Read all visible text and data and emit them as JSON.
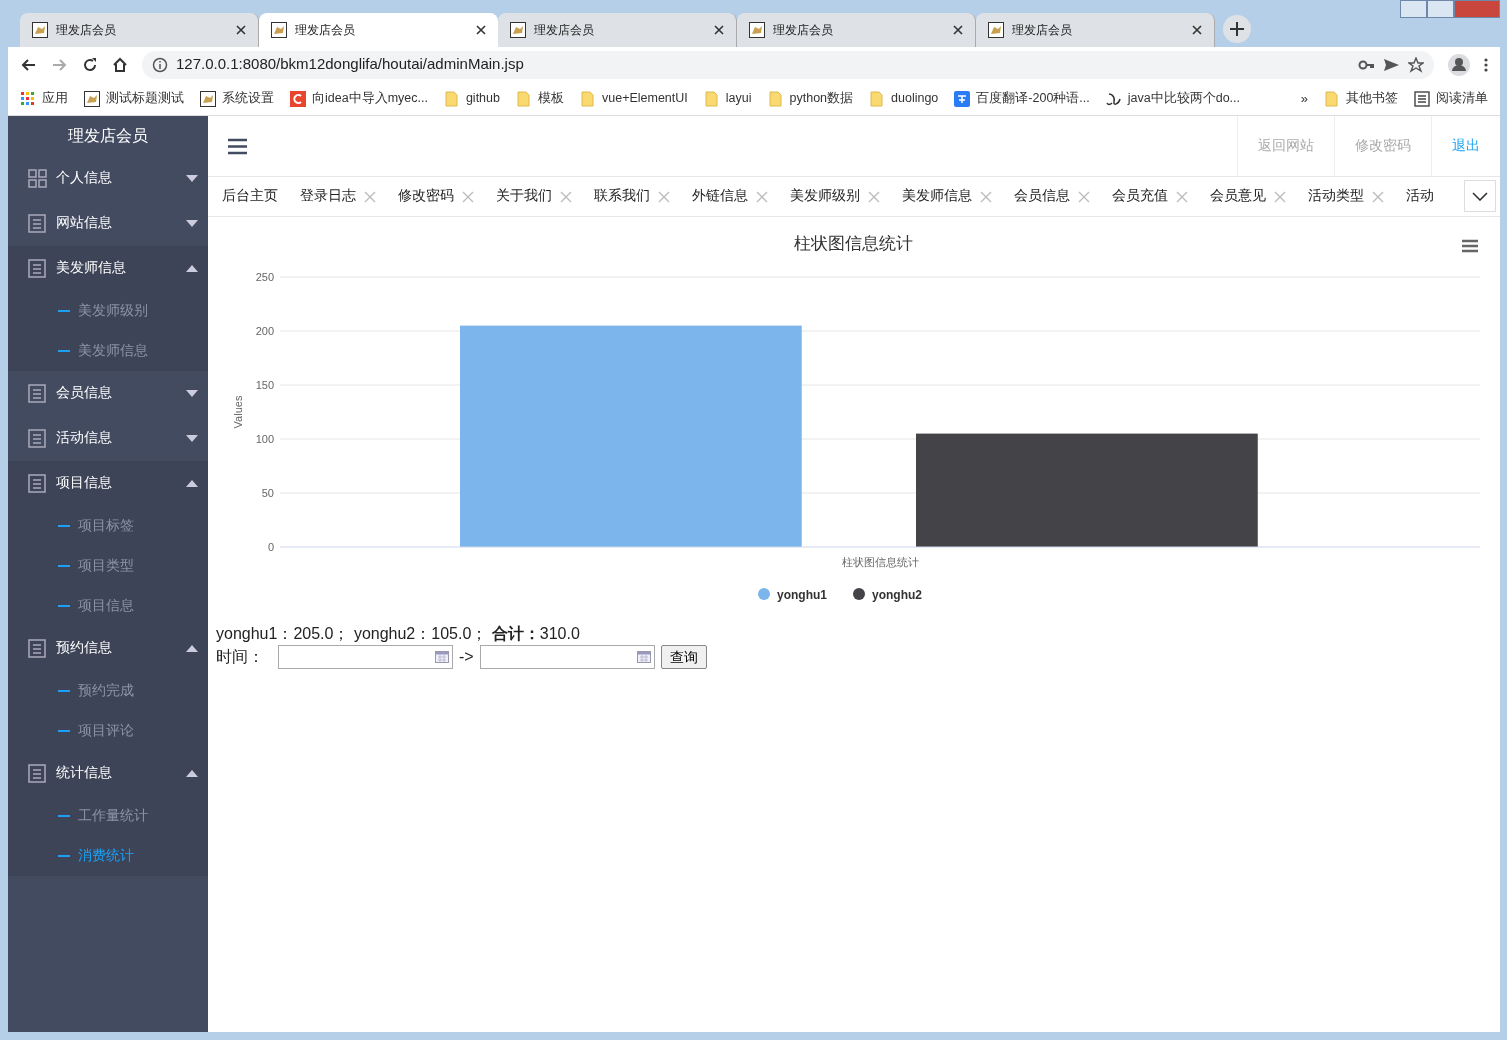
{
  "browser": {
    "tabs": [
      {
        "title": "理发店会员",
        "selected": false
      },
      {
        "title": "理发店会员",
        "selected": true
      },
      {
        "title": "理发店会员",
        "selected": false
      },
      {
        "title": "理发店会员",
        "selected": false
      },
      {
        "title": "理发店会员",
        "selected": false
      }
    ],
    "address": {
      "url": "127.0.0.1:8080/bkm12donglifa/houtai/adminMain.jsp"
    },
    "bookmarks": [
      {
        "label": "应用",
        "kind": "apps"
      },
      {
        "label": "测试标题测试",
        "kind": "page"
      },
      {
        "label": "系统设置",
        "kind": "page"
      },
      {
        "label": "向idea中导入myec...",
        "kind": "red"
      },
      {
        "label": "github",
        "kind": "folder"
      },
      {
        "label": "模板",
        "kind": "folder"
      },
      {
        "label": "vue+ElementUI",
        "kind": "folder"
      },
      {
        "label": "layui",
        "kind": "folder"
      },
      {
        "label": "python数据",
        "kind": "folder"
      },
      {
        "label": "duolingo",
        "kind": "folder"
      },
      {
        "label": "百度翻译-200种语...",
        "kind": "translate"
      },
      {
        "label": "java中比较两个do...",
        "kind": "link"
      }
    ],
    "more": "»",
    "other_bookmarks": "其他书签",
    "reading_list": "阅读清单"
  },
  "sidebar": {
    "title": "理发店会员",
    "groups": [
      {
        "label": "个人信息",
        "kind": "grid",
        "expanded": false
      },
      {
        "label": "网站信息",
        "kind": "list",
        "expanded": false
      },
      {
        "label": "美发师信息",
        "kind": "list",
        "expanded": true,
        "children": [
          {
            "label": "美发师级别",
            "selected": false
          },
          {
            "label": "美发师信息",
            "selected": false
          }
        ]
      },
      {
        "label": "会员信息",
        "kind": "list",
        "expanded": false
      },
      {
        "label": "活动信息",
        "kind": "list",
        "expanded": false
      },
      {
        "label": "项目信息",
        "kind": "list",
        "expanded": true,
        "children": [
          {
            "label": "项目标签",
            "selected": false
          },
          {
            "label": "项目类型",
            "selected": false
          },
          {
            "label": "项目信息",
            "selected": false
          }
        ]
      },
      {
        "label": "预约信息",
        "kind": "list",
        "expanded": true,
        "children": [
          {
            "label": "预约完成",
            "selected": false
          },
          {
            "label": "项目评论",
            "selected": false
          }
        ]
      },
      {
        "label": "统计信息",
        "kind": "list",
        "expanded": true,
        "children": [
          {
            "label": "工作量统计",
            "selected": false
          },
          {
            "label": "消费统计",
            "selected": true
          }
        ]
      }
    ]
  },
  "header": {
    "links": [
      {
        "label": "返回网站",
        "kind": "muted"
      },
      {
        "label": "修改密码",
        "kind": "muted"
      },
      {
        "label": "退出",
        "kind": "primary"
      }
    ]
  },
  "page_tabs": [
    {
      "label": "后台主页",
      "closable": false
    },
    {
      "label": "登录日志",
      "closable": true
    },
    {
      "label": "修改密码",
      "closable": true
    },
    {
      "label": "关于我们",
      "closable": true
    },
    {
      "label": "联系我们",
      "closable": true
    },
    {
      "label": "外链信息",
      "closable": true
    },
    {
      "label": "美发师级别",
      "closable": true
    },
    {
      "label": "美发师信息",
      "closable": true
    },
    {
      "label": "会员信息",
      "closable": true
    },
    {
      "label": "会员充值",
      "closable": true
    },
    {
      "label": "会员意见",
      "closable": true
    },
    {
      "label": "活动类型",
      "closable": true
    },
    {
      "label": "活动",
      "closable": false
    }
  ],
  "chart": {
    "chart_data": {
      "type": "bar",
      "title": "柱状图信息统计",
      "ylabel": "Values",
      "categories": [
        "柱状图信息统计"
      ],
      "series": [
        {
          "name": "yonghu1",
          "color": "#7cb5ec",
          "values": [
            205
          ]
        },
        {
          "name": "yonghu2",
          "color": "#434348",
          "values": [
            105
          ]
        }
      ],
      "ylim": [
        0,
        250
      ],
      "yticks": [
        0,
        50,
        100,
        150,
        200,
        250
      ],
      "grid": true,
      "legend": true
    }
  },
  "summary": "yonghu1：205.0； yonghu2：105.0； **合计：**310.0",
  "filter": {
    "label": "时间：",
    "separator": "->",
    "button": "查询"
  }
}
